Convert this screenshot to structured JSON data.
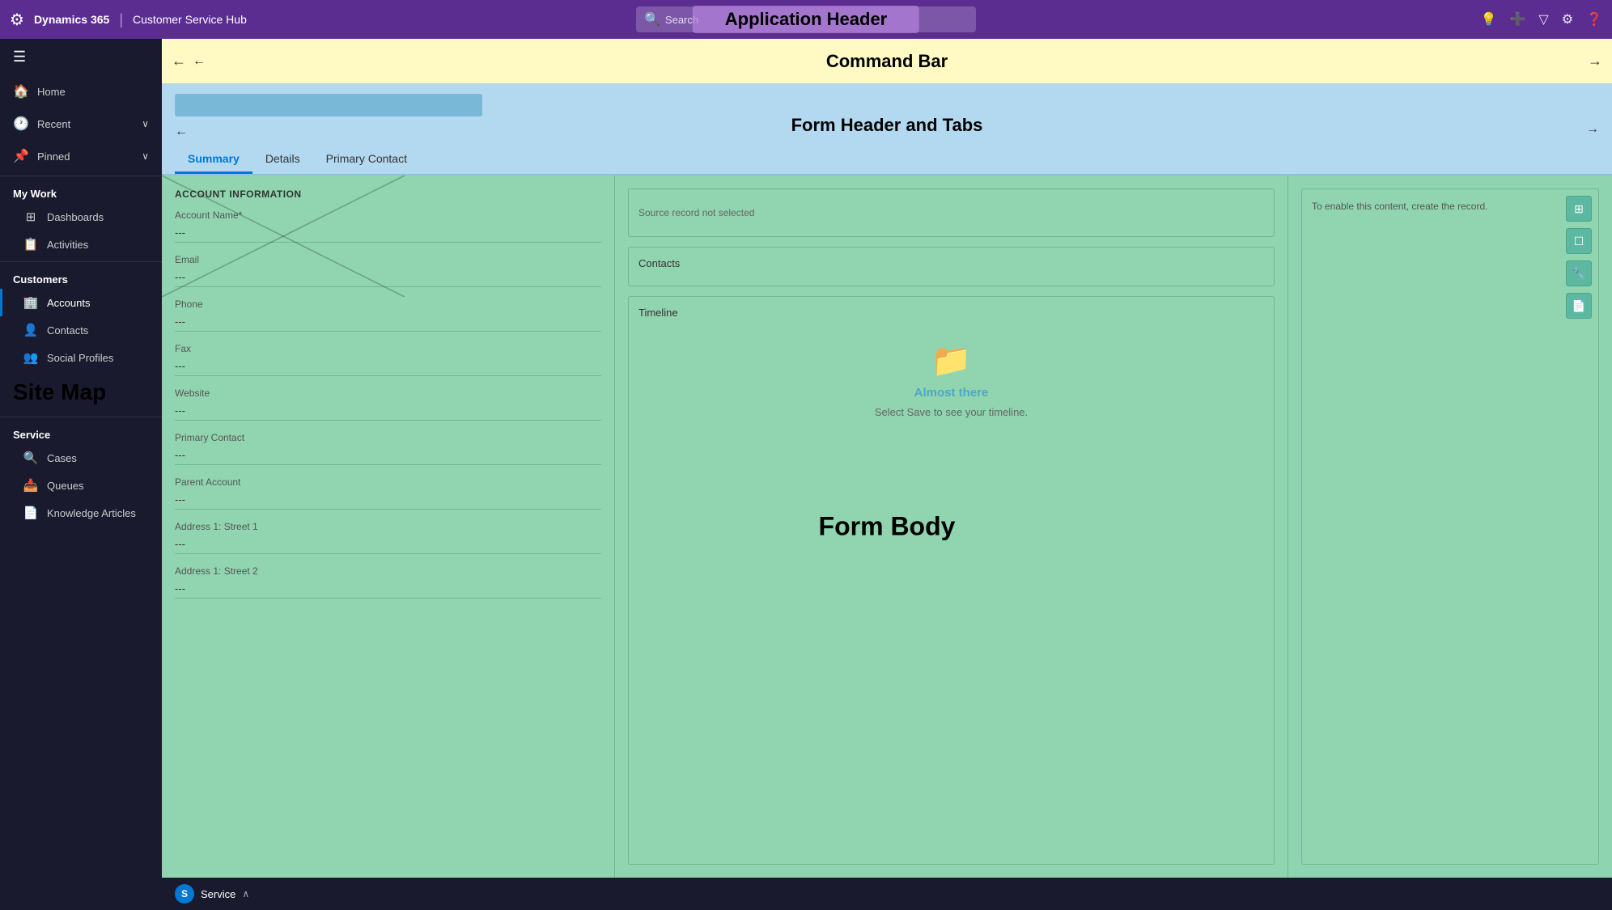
{
  "app": {
    "logo": "⚙",
    "title": "Dynamics 365",
    "divider": "|",
    "app_name": "Customer Service Hub",
    "search_placeholder": "Search",
    "header_label": "Application Header",
    "icons": {
      "light": "💡",
      "plus": "+",
      "filter": "⊿",
      "settings": "⚙",
      "help": "?"
    }
  },
  "command_bar": {
    "label": "Command Bar",
    "back_icon": "←",
    "left_arrow": "←",
    "right_arrow": "→"
  },
  "form_header": {
    "label": "Form Header and Tabs",
    "left_arrow": "←",
    "right_arrow": "→",
    "tabs": [
      {
        "id": "summary",
        "label": "Summary",
        "active": true
      },
      {
        "id": "details",
        "label": "Details",
        "active": false
      },
      {
        "id": "primary-contact",
        "label": "Primary Contact",
        "active": false
      }
    ]
  },
  "form_body": {
    "label": "Form Body",
    "left_col": {
      "section_title": "ACCOUNT INFORMATION",
      "fields": [
        {
          "label": "Account Name*",
          "value": "---"
        },
        {
          "label": "Email",
          "value": "---"
        },
        {
          "label": "Phone",
          "value": "---"
        },
        {
          "label": "Fax",
          "value": "---"
        },
        {
          "label": "Website",
          "value": "---"
        },
        {
          "label": "Primary Contact",
          "value": "---"
        },
        {
          "label": "Parent Account",
          "value": "---"
        },
        {
          "label": "Address 1: Street 1",
          "value": "---"
        },
        {
          "label": "Address 1: Street 2",
          "value": "---"
        }
      ]
    },
    "middle_col": {
      "source_panel": {
        "text": "Source record not selected"
      },
      "contacts_panel": {
        "title": "Contacts"
      },
      "timeline_panel": {
        "title": "Timeline",
        "icon": "📁",
        "heading": "Almost there",
        "subtext": "Select Save to see your timeline."
      }
    },
    "right_col": {
      "top_text": "To enable this content, create the record.",
      "icons": [
        "⊞",
        "☐",
        "🔧",
        "📄"
      ]
    }
  },
  "sidebar": {
    "toggle_icon": "☰",
    "nav_items": [
      {
        "id": "home",
        "icon": "🏠",
        "label": "Home"
      },
      {
        "id": "recent",
        "icon": "🕐",
        "label": "Recent",
        "chevron": "∨"
      },
      {
        "id": "pinned",
        "icon": "📌",
        "label": "Pinned",
        "chevron": "∨"
      }
    ],
    "my_work": {
      "header": "My Work",
      "items": [
        {
          "id": "dashboards",
          "icon": "⊞",
          "label": "Dashboards"
        },
        {
          "id": "activities",
          "icon": "📋",
          "label": "Activities"
        }
      ]
    },
    "customers": {
      "header": "Customers",
      "items": [
        {
          "id": "accounts",
          "icon": "🏢",
          "label": "Accounts",
          "active": true
        },
        {
          "id": "contacts",
          "icon": "👤",
          "label": "Contacts"
        },
        {
          "id": "social-profiles",
          "icon": "👥",
          "label": "Social Profiles"
        }
      ]
    },
    "service": {
      "header": "Service",
      "items": [
        {
          "id": "cases",
          "icon": "🔍",
          "label": "Cases"
        },
        {
          "id": "queues",
          "icon": "📥",
          "label": "Queues"
        },
        {
          "id": "knowledge-articles",
          "icon": "📄",
          "label": "Knowledge Articles"
        }
      ]
    },
    "sitemap_label": "Site Map"
  },
  "bottom_bar": {
    "app_icon_letter": "S",
    "app_name": "Service",
    "chevron": "∧"
  }
}
